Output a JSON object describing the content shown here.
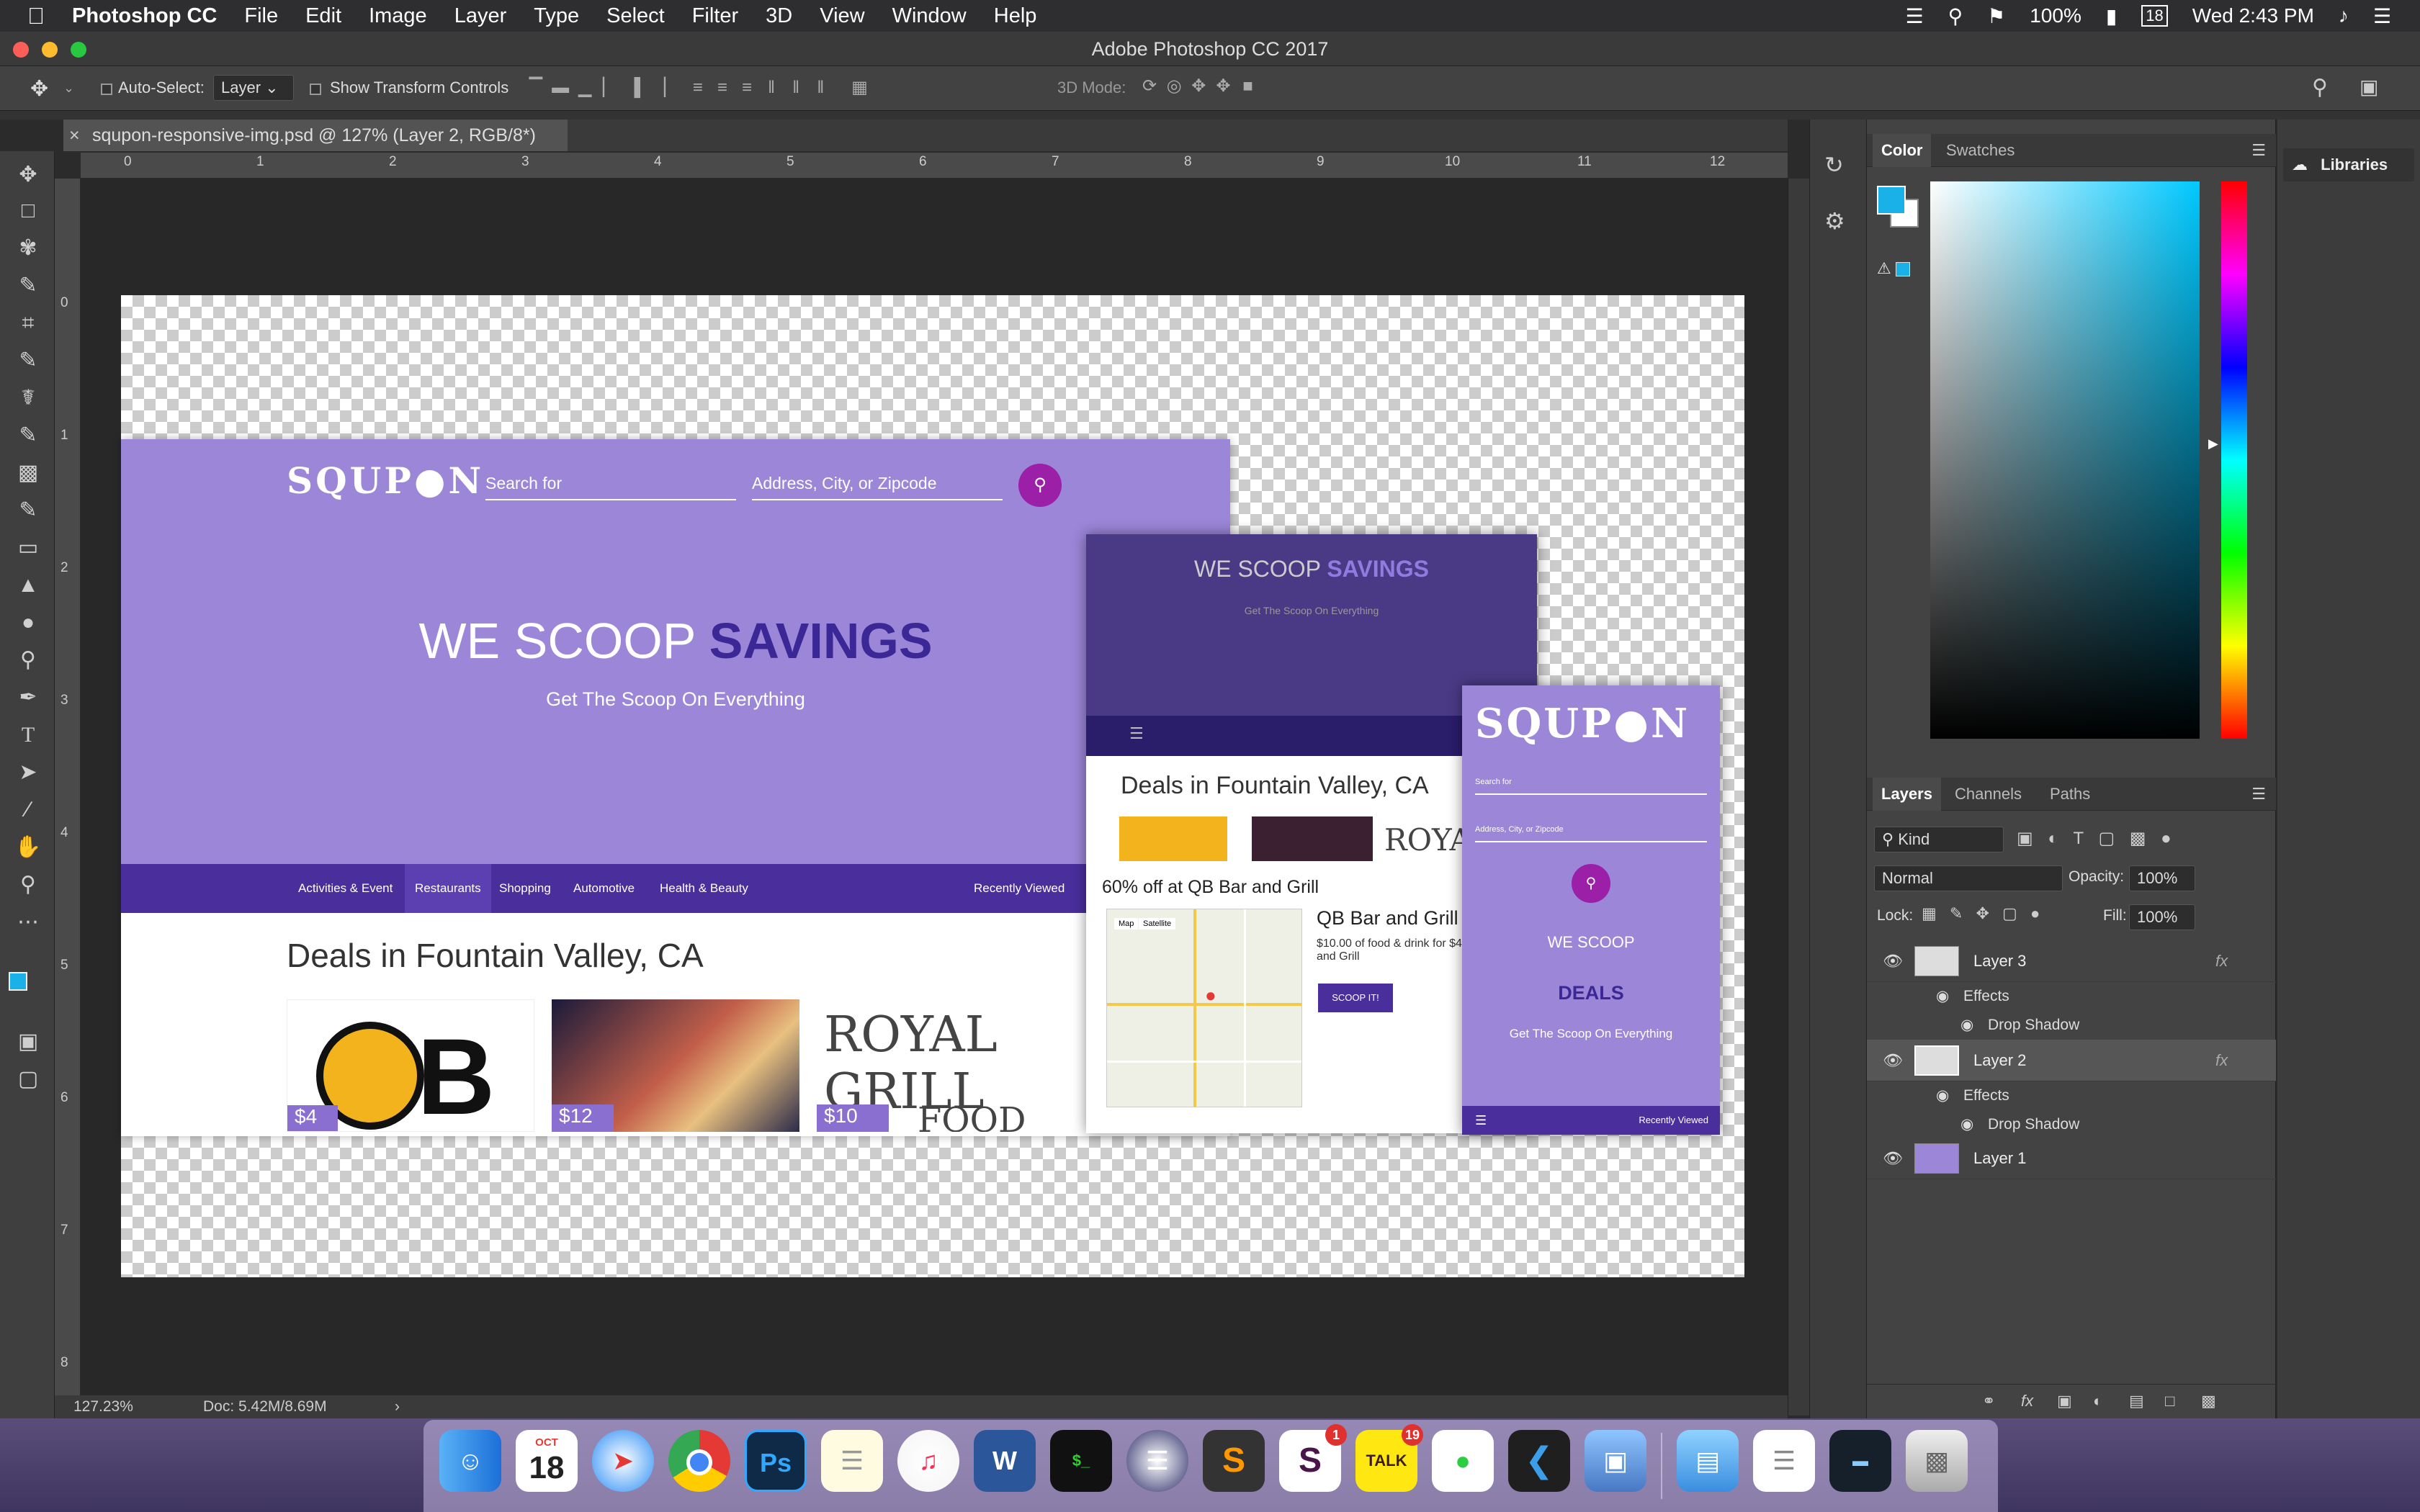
{
  "menubar": {
    "app_name": "Photoshop CC",
    "items": [
      "File",
      "Edit",
      "Image",
      "Layer",
      "Type",
      "Select",
      "Filter",
      "3D",
      "View",
      "Window",
      "Help"
    ],
    "battery": "100%",
    "date": "18",
    "clock": "Wed 2:43 PM"
  },
  "window": {
    "title": "Adobe Photoshop CC 2017"
  },
  "options": {
    "auto_select_label": "Auto-Select:",
    "auto_select_value": "Layer",
    "transform_label": "Show Transform Controls",
    "mode3d_label": "3D Mode:"
  },
  "document": {
    "tab_title": "squpon-responsive-img.psd @ 127% (Layer 2, RGB/8*)",
    "zoom": "127.23%",
    "doc_size": "Doc: 5.42M/8.69M"
  },
  "ruler": {
    "top": [
      "0",
      "1",
      "2",
      "3",
      "4",
      "5",
      "6",
      "7",
      "8",
      "9",
      "10",
      "11",
      "12"
    ],
    "left": [
      "0",
      "1",
      "2",
      "3",
      "4",
      "5",
      "6",
      "7",
      "8"
    ]
  },
  "mockup": {
    "logo": "SQUP●N",
    "search_placeholder": "Search for",
    "address_placeholder": "Address, City, or Zipcode",
    "hero_title_a": "WE SCOOP",
    "hero_title_b": "SAVINGS",
    "hero_sub": "Get The Scoop On Everything",
    "nav": [
      "Activities & Event",
      "Restaurants",
      "Shopping",
      "Automotive",
      "Health & Beauty"
    ],
    "nav_right": "Recently Viewed",
    "deals_title": "Deals in Fountain Valley, CA",
    "tablet_deal": "60% off at QB Bar and Grill",
    "tablet_biz": "QB Bar and Grill",
    "tablet_desc": "$10.00 of food & drink for $4 at QB Bar and Grill",
    "tablet_button": "SCOOP IT!",
    "map_btn1": "Map",
    "map_btn2": "Satellite",
    "price1": "$4",
    "price2": "$12",
    "price3": "$10",
    "royal": "ROYAL GRILL",
    "royal_food": "FOOD",
    "phone_we": "WE SCOOP",
    "phone_deals": "DEALS"
  },
  "color_panel": {
    "tabs": [
      "Color",
      "Swatches"
    ],
    "fg": "#1ab0e8",
    "bg": "#ffffff"
  },
  "layers_panel": {
    "tabs": [
      "Layers",
      "Channels",
      "Paths"
    ],
    "kind": "Kind",
    "blend": "Normal",
    "opacity_label": "Opacity:",
    "opacity": "100%",
    "lock_label": "Lock:",
    "fill_label": "Fill:",
    "fill": "100%",
    "layers": [
      {
        "name": "Layer 3",
        "effects": "Effects",
        "effect": "Drop Shadow"
      },
      {
        "name": "Layer 2",
        "effects": "Effects",
        "effect": "Drop Shadow"
      },
      {
        "name": "Layer 1"
      }
    ]
  },
  "libraries": {
    "label": "Libraries"
  },
  "dock": {
    "calendar_month": "OCT",
    "calendar_day": "18",
    "ps_label": "Ps",
    "word_label": "W",
    "slack_badge": "1",
    "talk_badge": "19",
    "talk_label": "TALK"
  }
}
